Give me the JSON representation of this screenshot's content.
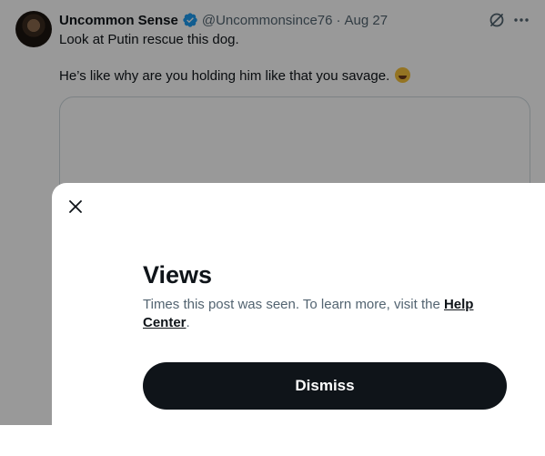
{
  "tweet": {
    "display_name": "Uncommon Sense",
    "handle": "@Uncommonsince76",
    "separator": "·",
    "date": "Aug 27",
    "text_line1": "Look at Putin rescue this dog.",
    "text_line2": "He’s like why are you holding him like that you savage."
  },
  "modal": {
    "title": "Views",
    "description": "Times this post was seen. To learn more, visit the ",
    "link_text": "Help Center",
    "trailing": ".",
    "dismiss_label": "Dismiss"
  },
  "colors": {
    "text_primary": "#0f1419",
    "text_secondary": "#536471",
    "verified_blue": "#1d9bf0",
    "button_bg": "#0f1419",
    "overlay": "rgba(0,0,0,0.4)"
  },
  "icons": {
    "verified": "verified-badge-icon",
    "grok": "grok-icon",
    "more": "more-icon",
    "close": "close-icon",
    "emoji": "laughing-tears-emoji-icon"
  }
}
